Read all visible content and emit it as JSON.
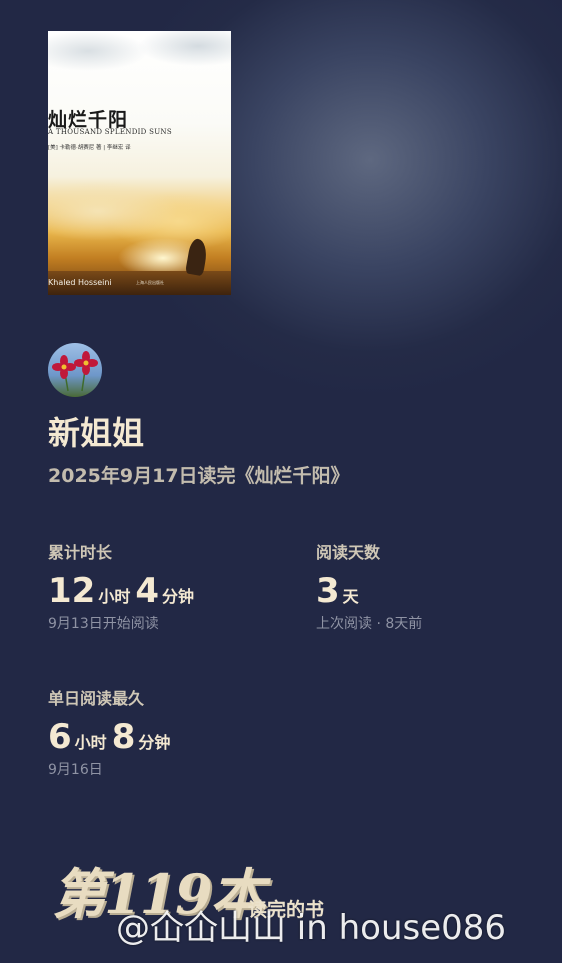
{
  "book": {
    "cover_title": "灿烂千阳",
    "cover_subtitle": "A THOUSAND SPLENDID SUNS",
    "cover_credit": "[美] 卡勒德·胡赛尼 著 | 李继宏 译",
    "cover_author": "Khaled Hosseini",
    "cover_publisher": "上海人民出版社"
  },
  "user": {
    "name": "新姐姐",
    "finished_line": "2025年9月17日读完《灿烂千阳》"
  },
  "stats": {
    "total_time": {
      "label": "累计时长",
      "hours": "12",
      "hours_unit": "小时",
      "minutes": "4",
      "minutes_unit": "分钟",
      "sub": "9月13日开始阅读"
    },
    "reading_days": {
      "label": "阅读天数",
      "days": "3",
      "days_unit": "天",
      "sub": "上次阅读 · 8天前"
    },
    "longest_day": {
      "label": "单日阅读最久",
      "hours": "6",
      "hours_unit": "小时",
      "minutes": "8",
      "minutes_unit": "分钟",
      "sub": "9月16日"
    }
  },
  "rank": {
    "label": "第119本",
    "suffix": "读完的书"
  },
  "watermark": "@仚仚山山 in house086"
}
